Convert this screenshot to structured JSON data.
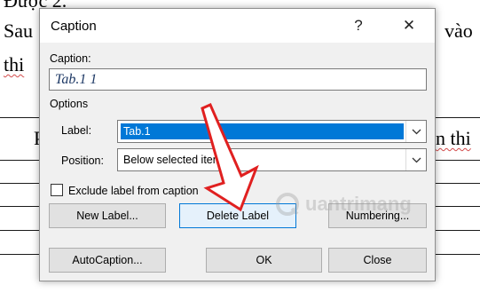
{
  "document": {
    "line_top": "Được 2.",
    "line1_left": "Sau",
    "line1_right": "vào",
    "line2_left": "thi",
    "line3_left": "P",
    "line3_right": "n thi"
  },
  "dialog": {
    "title": "Caption",
    "help": "?",
    "close": "✕",
    "caption_label": "Caption:",
    "caption_value": "Tab.1 1",
    "options_label": "Options",
    "label_label": "Label:",
    "label_value": "Tab.1",
    "position_label": "Position:",
    "position_value": "Below selected item",
    "exclude_label": "Exclude label from caption",
    "exclude_checked": false,
    "buttons": {
      "new_label": "New Label...",
      "delete_label": "Delete Label",
      "numbering": "Numbering...",
      "autocaption": "AutoCaption...",
      "ok": "OK",
      "cancel": "Close"
    }
  },
  "watermark": {
    "text": "uantrimang"
  },
  "colors": {
    "accent": "#0078d7",
    "arrow": "#e02020",
    "caption_text": "#1f3a66"
  }
}
